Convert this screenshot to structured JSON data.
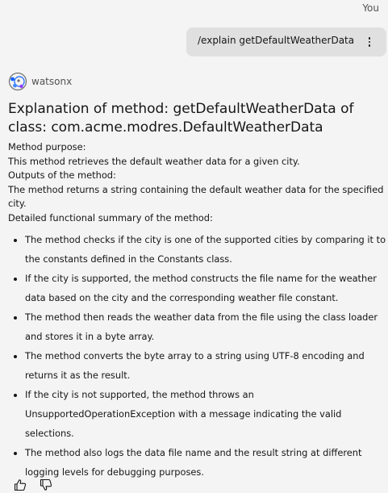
{
  "user": {
    "name": "You",
    "message": "/explain getDefaultWeatherData"
  },
  "bot": {
    "name": "watsonx"
  },
  "answer": {
    "title": "Explanation of method: getDefaultWeatherData of class: com.acme.modres.DefaultWeatherData",
    "purpose_label": "Method purpose:",
    "purpose_text": "This method retrieves the default weather data for a given city.",
    "outputs_label": "Outputs of the method:",
    "outputs_text": "The method returns a string containing the default weather data for the specified city.",
    "summary_label": "Detailed functional summary of the method:",
    "summary_items": [
      "The method checks if the city is one of the supported cities by comparing it to the constants defined in the Constants class.",
      "If the city is supported, the method constructs the file name for the weather data based on the city and the corresponding weather file constant.",
      "The method then reads the weather data from the file using the class loader and stores it in a byte array.",
      "The method converts the byte array to a string using UTF-8 encoding and returns it as the result.",
      "If the city is not supported, the method throws an UnsupportedOperationException with a message indicating the valid selections.",
      "The method also logs the data file name and the result string at different logging levels for debugging purposes."
    ]
  },
  "icons": {
    "overflow": "overflow-menu-vertical-icon",
    "avatar": "watsonx-logo-icon",
    "thumbs_up": "thumbs-up-icon",
    "thumbs_down": "thumbs-down-icon"
  },
  "colors": {
    "background": "#f4f4f4",
    "user_bubble": "#e0e0e0",
    "text": "#161616",
    "secondary_text": "#525252",
    "avatar_accent": "#0f62fe"
  }
}
